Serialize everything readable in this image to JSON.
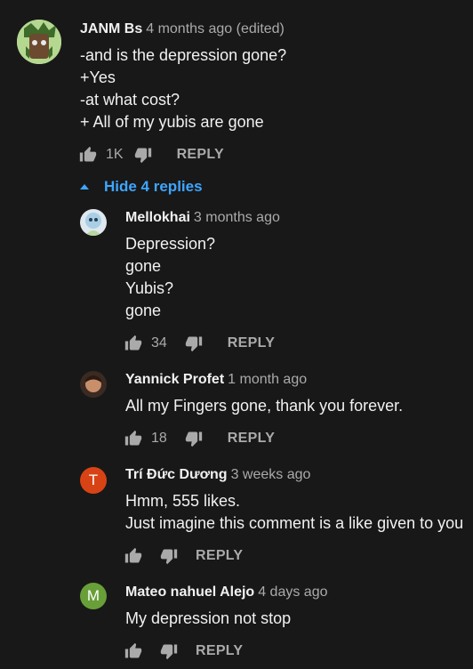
{
  "main_comment": {
    "author": "JANM Bs",
    "time": "4 months ago (edited)",
    "lines": [
      "-and is the depression gone?",
      "+Yes",
      "-at what cost?",
      "+ All of my yubis are gone"
    ],
    "likes": "1K",
    "reply_label": "REPLY"
  },
  "replies_toggle": {
    "label": "Hide 4 replies",
    "icon": "caret-up-icon"
  },
  "replies": [
    {
      "author": "Mellokhai",
      "time": "3 months ago",
      "lines": [
        "Depression?",
        "gone",
        "Yubis?",
        "gone"
      ],
      "likes": "34",
      "reply_label": "REPLY",
      "avatar": "image"
    },
    {
      "author": "Yannick Profet",
      "time": "1 month ago",
      "lines": [
        "All my Fingers gone, thank you forever."
      ],
      "likes": "18",
      "reply_label": "REPLY",
      "avatar": "image"
    },
    {
      "author": "Trí Đức Dương",
      "time": "3 weeks ago",
      "lines": [
        "Hmm, 555 likes.",
        "Just imagine this comment is a like given to you"
      ],
      "likes": "",
      "reply_label": "REPLY",
      "avatar_letter": "T",
      "avatar_color": "#d84315"
    },
    {
      "author": "Mateo nahuel Alejo",
      "time": "4 days ago",
      "lines": [
        "My depression not stop"
      ],
      "likes": "",
      "reply_label": "REPLY",
      "avatar_letter": "M",
      "avatar_color": "#689f38"
    }
  ],
  "colors": {
    "background": "#181818",
    "link": "#3ea6ff",
    "muted": "#aaaaaa",
    "text": "#f1f1f1"
  }
}
